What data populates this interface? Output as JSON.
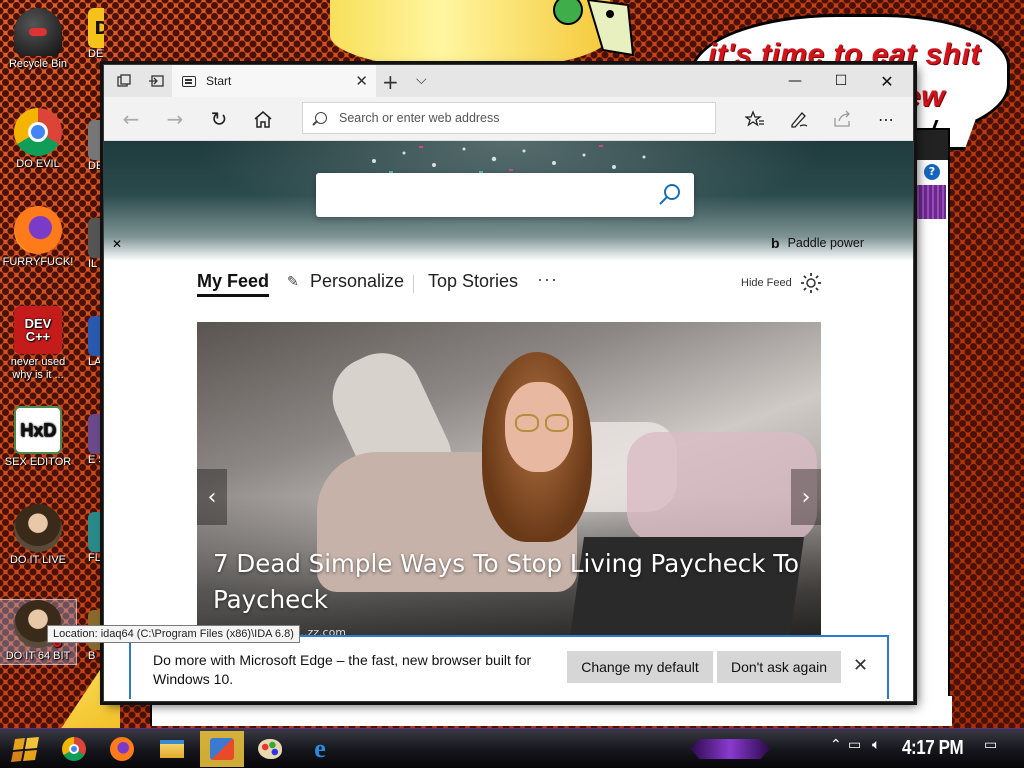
{
  "speech_bubble": {
    "line1": "it's time to eat shit",
    "line2": "ew"
  },
  "desktop_icons": [
    {
      "label": "Recycle Bin",
      "icon": "recycle-bin-icon"
    },
    {
      "label": "DO EVIL",
      "icon": "chrome-icon"
    },
    {
      "label": "FURRYFUCK!",
      "icon": "firefox-icon"
    },
    {
      "label": "never used why is it ...",
      "icon": "devcpp-icon",
      "badge": "DEV C++"
    },
    {
      "label": "SEX EDITOR",
      "icon": "hxd-icon",
      "badge": "HxD"
    },
    {
      "label": "DO IT LIVE",
      "icon": "ida-portrait-icon"
    },
    {
      "label": "DO IT 64 BIT",
      "icon": "ida64-portrait-icon",
      "badge": "6"
    }
  ],
  "desktop_icons_col2": [
    {
      "label": "DET",
      "badge": "De"
    },
    {
      "label": "DE HA"
    },
    {
      "label": "IL"
    },
    {
      "label": "LAN"
    },
    {
      "label": "E SIM"
    },
    {
      "label": "FL"
    },
    {
      "label": "B"
    }
  ],
  "tooltip": "Location: idaq64 (C:\\Program Files (x86)\\IDA 6.8)",
  "browser": {
    "tab_title": "Start",
    "address_placeholder": "Search or enter web address",
    "search_placeholder": "",
    "bing_caption": "Paddle power",
    "feed_tabs": {
      "my_feed": "My Feed",
      "personalize": "Personalize",
      "top_stories": "Top Stories",
      "more": "···"
    },
    "hide_feed": "Hide Feed",
    "article": {
      "headline": "7 Dead Simple Ways To Stop Living Paycheck To Paycheck",
      "source": "...zz.com"
    },
    "notification": {
      "text": "Do more with Microsoft Edge – the fast, new browser built for Windows 10.",
      "primary_button": "Change my default",
      "secondary_button": "Don't ask again"
    }
  },
  "taskbar": {
    "apps": [
      "start-icon",
      "chrome-icon",
      "firefox-icon",
      "file-explorer-icon",
      "paint-icon",
      "paint-palette-icon",
      "edge-icon"
    ],
    "clock": "4:17 PM"
  },
  "colors": {
    "accent_blue": "#2d7bd0",
    "speech_red": "#d4141c",
    "taskbar_purple": "#8a3ad0"
  }
}
